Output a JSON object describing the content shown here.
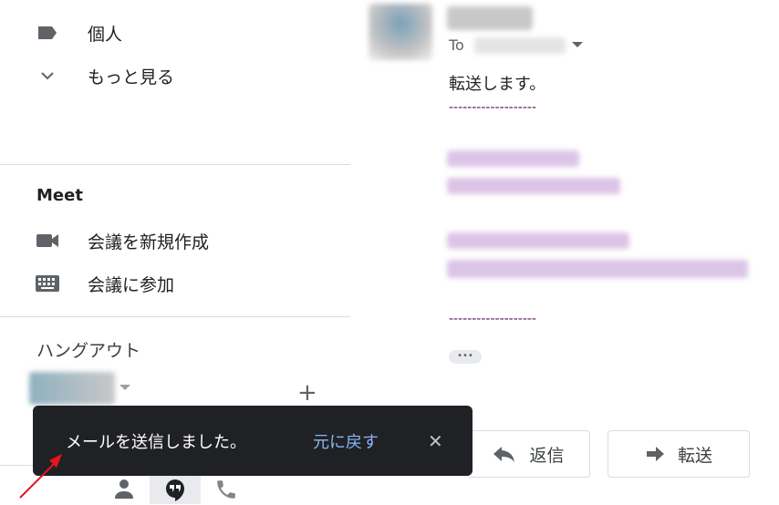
{
  "sidebar": {
    "labels": [
      {
        "label": "個人",
        "icon": "label-icon"
      },
      {
        "label": "もっと見る",
        "icon": "chevron-down-icon"
      }
    ],
    "meet": {
      "heading": "Meet",
      "items": [
        {
          "label": "会議を新規作成",
          "icon": "video-camera-icon"
        },
        {
          "label": "会議に参加",
          "icon": "keyboard-icon"
        }
      ]
    },
    "hangouts": {
      "heading": "ハングアウト",
      "add": "+"
    }
  },
  "email": {
    "to_label": "To",
    "body": "転送します。",
    "separator": "-------------------",
    "separator_color": "#5b0f5e",
    "reply_label": "返信",
    "forward_label": "転送"
  },
  "snackbar": {
    "message": "メールを送信しました。",
    "undo": "元に戻す",
    "undo_color": "#8ab4f8",
    "close": "✕"
  },
  "annotation_arrow_color": "#e8141c"
}
